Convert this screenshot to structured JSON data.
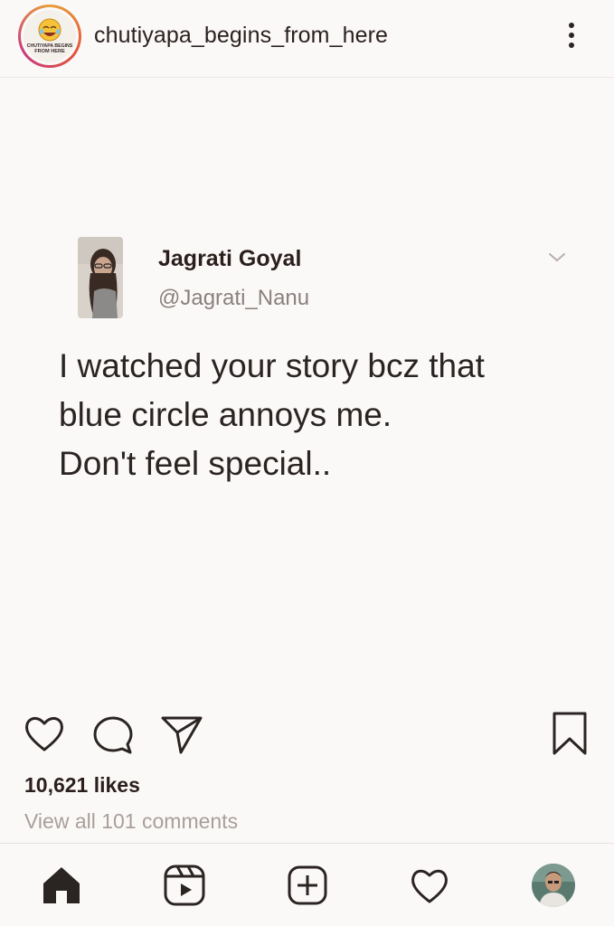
{
  "header": {
    "username": "chutiyapa_begins_from_here",
    "avatar_text_line1": "CHUTIYAPA BEGINS",
    "avatar_text_line2": "FROM HERE",
    "more_icon": "more-vertical-icon"
  },
  "tweet": {
    "author_name": "Jagrati Goyal",
    "author_handle": "@Jagrati_Nanu",
    "text_lines": [
      "I watched your story bcz that",
      "blue circle annoys me.",
      "Don't feel special.."
    ],
    "menu_icon": "chevron-down-icon"
  },
  "actions": {
    "like_icon": "heart-icon",
    "comment_icon": "comment-icon",
    "share_icon": "send-icon",
    "save_icon": "bookmark-icon"
  },
  "stats": {
    "likes": "10,621 likes",
    "view_comments": "View all 101 comments"
  },
  "bottom_nav": {
    "items": [
      {
        "icon": "home-icon"
      },
      {
        "icon": "reels-icon"
      },
      {
        "icon": "add-post-icon"
      },
      {
        "icon": "activity-heart-icon"
      },
      {
        "icon": "profile-avatar"
      }
    ]
  },
  "colors": {
    "background": "#fbf9f8",
    "text": "#2a2422",
    "muted": "#a99e9a",
    "story_ring": "#e2563d"
  }
}
